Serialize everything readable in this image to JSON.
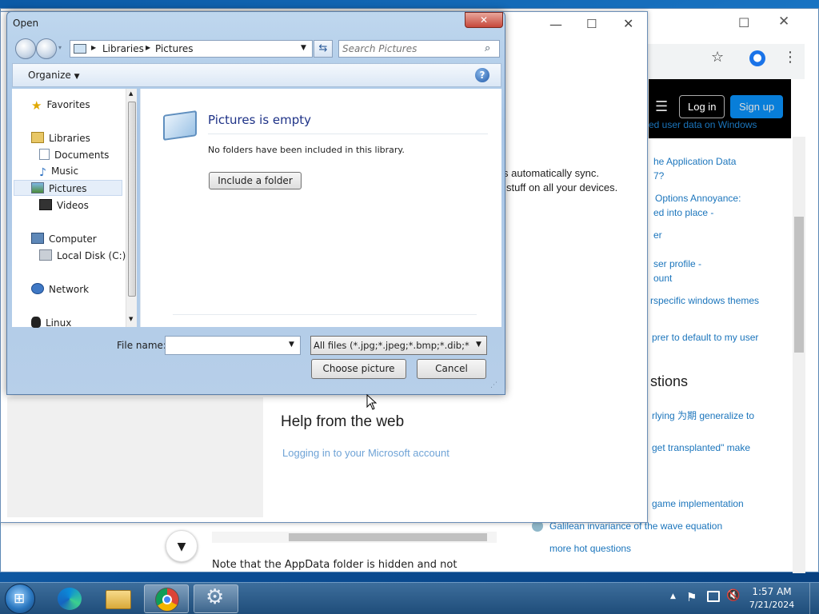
{
  "browser": {
    "so_login": "Log in",
    "so_signup": "Sign up",
    "sidebar_links": [
      "ed user data on Windows",
      "he Application Data",
      "7?",
      "Options Annoyance:",
      "ed into place -",
      "er",
      "ser profile -",
      "ount",
      "rspecific windows themes",
      "prer to default to my user"
    ],
    "hot_heading": "stions",
    "hot_links": [
      "rlying 为期 generalize to",
      "get transplanted\" make",
      "game implementation",
      "Galilean invariance of the wave equation",
      "more hot questions"
    ],
    "bottom_text": "Note that the  AppData  folder is hidden and not"
  },
  "settings": {
    "sync_line1": "s automatically sync.",
    "sync_line2": "stuff on all your devices.",
    "help_heading": "Help from the web",
    "help_link": "Logging in to your Microsoft account"
  },
  "dialog": {
    "title": "Open",
    "breadcrumb": [
      "Libraries",
      "Pictures"
    ],
    "search_placeholder": "Search Pictures",
    "organize": "Organize",
    "nav": {
      "favorites": "Favorites",
      "libraries": "Libraries",
      "documents": "Documents",
      "music": "Music",
      "pictures": "Pictures",
      "videos": "Videos",
      "computer": "Computer",
      "local_disk": "Local Disk (C:)",
      "network": "Network",
      "linux": "Linux"
    },
    "empty_title": "Pictures is empty",
    "empty_desc": "No folders have been included in this library.",
    "include_button": "Include a folder",
    "filename_label": "File name:",
    "filename_value": "",
    "filetype": "All files (*.jpg;*.jpeg;*.bmp;*.dib;*.png",
    "choose_button": "Choose picture",
    "cancel_button": "Cancel"
  },
  "taskbar": {
    "time": "1:57 AM",
    "date": "7/21/2024"
  },
  "colors": {
    "link": "#1b75bc",
    "dialog_frame": "#a9c6e6",
    "taskbar": "#2a5a88",
    "selected_nav": "#e5eef9"
  }
}
